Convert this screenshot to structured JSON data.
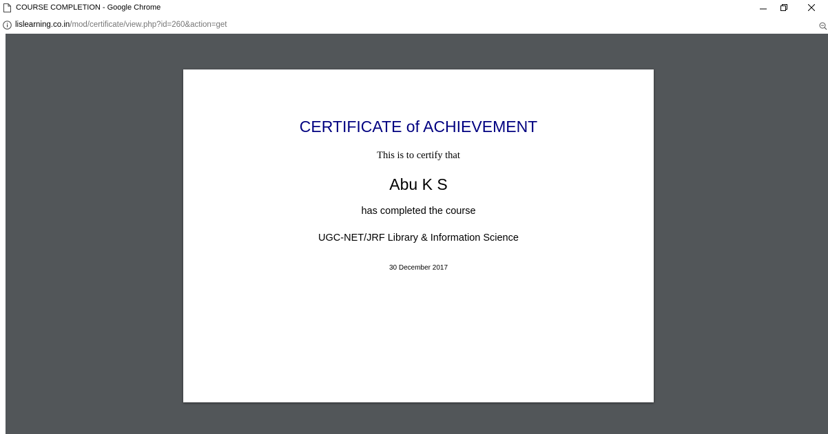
{
  "window": {
    "title": "COURSE COMPLETION - Google Chrome",
    "icon": "page-icon"
  },
  "address_bar": {
    "host": "lislearning.co.in",
    "path": "/mod/certificate/view.php?id=260&action=get",
    "icon": "info-icon"
  },
  "certificate": {
    "title": "CERTIFICATE of ACHIEVEMENT",
    "certify_text": "This is to certify that",
    "name": "Abu K S",
    "completed_text": "has completed the course",
    "course": "UGC-NET/JRF Library & Information Science",
    "date": "30 December 2017"
  },
  "colors": {
    "viewer_background": "#525659",
    "title_color": "#000080"
  }
}
